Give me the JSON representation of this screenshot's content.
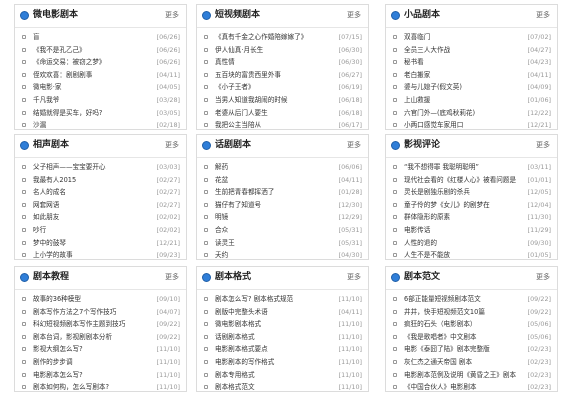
{
  "panels": [
    {
      "title": "微电影剧本",
      "more": "更多",
      "items": [
        {
          "title": "盲",
          "date": "[06/26]"
        },
        {
          "title": "《我不是孔乙己》",
          "date": "[06/26]"
        },
        {
          "title": "《命运交易：被窃之梦》",
          "date": "[06/26]"
        },
        {
          "title": "侄欢欢喜：剧剧剧事",
          "date": "[04/11]"
        },
        {
          "title": "微电影·家",
          "date": "[04/05]"
        },
        {
          "title": "千凡我爷",
          "date": "[03/28]"
        },
        {
          "title": "结婚就得是买车，好吗?",
          "date": "[03/05]"
        },
        {
          "title": "沙漏",
          "date": "[02/18]"
        }
      ]
    },
    {
      "title": "短视频剧本",
      "more": "更多",
      "items": [
        {
          "title": "《真有千金之心作婚陪嫁嫁了》",
          "date": "[07/15]"
        },
        {
          "title": "伊人仙真·月长生",
          "date": "[06/30]"
        },
        {
          "title": "真性情",
          "date": "[06/30]"
        },
        {
          "title": "五百块的富贵西里外事",
          "date": "[06/27]"
        },
        {
          "title": "《小子王者》",
          "date": "[06/19]"
        },
        {
          "title": "当男人知道我胡闹的时候",
          "date": "[06/18]"
        },
        {
          "title": "老婆从后门人要生",
          "date": "[06/18]"
        },
        {
          "title": "我把公主当陪从",
          "date": "[06/17]"
        }
      ]
    },
    {
      "title": "小品剧本",
      "more": "更多",
      "items": [
        {
          "title": "双喜临门",
          "date": "[07/02]"
        },
        {
          "title": "全员三人大作战",
          "date": "[04/27]"
        },
        {
          "title": "秘书看",
          "date": "[04/23]"
        },
        {
          "title": "老白搬家",
          "date": "[04/11]"
        },
        {
          "title": "婆与儿媳子(假文英)",
          "date": "[04/09]"
        },
        {
          "title": "上山救援",
          "date": "[01/06]"
        },
        {
          "title": "六官门外—(底鸡秋莉花)",
          "date": "[12/22]"
        },
        {
          "title": "小两口感觉车家用口",
          "date": "[12/21]"
        }
      ]
    },
    {
      "title": "相声剧本",
      "more": "更多",
      "items": [
        {
          "title": "父子相声——宝宝要开心",
          "date": "[03/03]"
        },
        {
          "title": "我最有人2015",
          "date": "[02/27]"
        },
        {
          "title": "名人的成名",
          "date": "[02/27]"
        },
        {
          "title": "网套网语",
          "date": "[02/27]"
        },
        {
          "title": "如此朋友",
          "date": "[02/02]"
        },
        {
          "title": "吵行",
          "date": "[02/02]"
        },
        {
          "title": "梦中的鼓琴",
          "date": "[12/21]"
        },
        {
          "title": "上小学的故事",
          "date": "[09/23]"
        }
      ]
    },
    {
      "title": "话剧剧本",
      "more": "更多",
      "items": [
        {
          "title": "解药",
          "date": "[06/06]"
        },
        {
          "title": "花盆",
          "date": "[04/11]"
        },
        {
          "title": "生前把青春都挥洒了",
          "date": "[01/28]"
        },
        {
          "title": "猫仔有了知道号",
          "date": "[12/30]"
        },
        {
          "title": "明镜",
          "date": "[12/29]"
        },
        {
          "title": "合众",
          "date": "[05/31]"
        },
        {
          "title": "读灵王",
          "date": "[05/31]"
        },
        {
          "title": "夭约",
          "date": "[04/30]"
        }
      ]
    },
    {
      "title": "影视评论",
      "more": "更多",
      "items": [
        {
          "title": "“我不想得罪 我聪明聪明”",
          "date": "[03/11]"
        },
        {
          "title": "现代社会看的《红楼人心》被看问题是",
          "date": "[01/01]"
        },
        {
          "title": "灵长是剧独乐剧的杀兵",
          "date": "[12/05]"
        },
        {
          "title": "童子伶的梦《女儿》的剧梦在",
          "date": "[12/04]"
        },
        {
          "title": "群体隐形的原素",
          "date": "[11/30]"
        },
        {
          "title": "电影传话",
          "date": "[11/29]"
        },
        {
          "title": "人性的退的",
          "date": "[09/30]"
        },
        {
          "title": "人生不是不能放",
          "date": "[01/05]"
        }
      ]
    },
    {
      "title": "剧本教程",
      "more": "更多",
      "items": [
        {
          "title": "故事的36种模型",
          "date": "[09/10]"
        },
        {
          "title": "剧本写作方法之7个写作技巧",
          "date": "[04/07]"
        },
        {
          "title": "科幻短视频剧本写作主题到技巧",
          "date": "[09/22]"
        },
        {
          "title": "剧本台词，影视剧剧本分析",
          "date": "[09/22]"
        },
        {
          "title": "影视大纲怎么写?",
          "date": "[11/10]"
        },
        {
          "title": "剧作的步步调",
          "date": "[11/10]"
        },
        {
          "title": "电影剧本怎么写?",
          "date": "[11/10]"
        },
        {
          "title": "剧本如何构，怎么写剧本?",
          "date": "[11/10]"
        }
      ]
    },
    {
      "title": "剧本格式",
      "more": "更多",
      "items": [
        {
          "title": "剧本怎么写? 剧本格式规范",
          "date": "[11/10]"
        },
        {
          "title": "剧版中完整头术语",
          "date": "[04/11]"
        },
        {
          "title": "微电影剧本格式",
          "date": "[11/10]"
        },
        {
          "title": "话剧剧本格式",
          "date": "[11/10]"
        },
        {
          "title": "电影剧本格式要点",
          "date": "[11/10]"
        },
        {
          "title": "电影剧本的写作格式",
          "date": "[11/10]"
        },
        {
          "title": "剧本专用格式",
          "date": "[11/10]"
        },
        {
          "title": "剧本格式范文",
          "date": "[11/10]"
        }
      ]
    },
    {
      "title": "剧本范文",
      "more": "更多",
      "items": [
        {
          "title": "6部正能量短视频剧本范文",
          "date": "[09/22]"
        },
        {
          "title": "井井，快手短视频范文10篇",
          "date": "[09/22]"
        },
        {
          "title": "疯狂的石头（电影剧本）",
          "date": "[05/06]"
        },
        {
          "title": "《我是歌唱者》中文剧本",
          "date": "[05/06]"
        },
        {
          "title": "电影《泰囧了陆》剧本完整版",
          "date": "[02/23]"
        },
        {
          "title": "灰仁杰之通天帝国 剧本",
          "date": "[02/23]"
        },
        {
          "title": "电影剧本范例及说明《黄昏之王》剧本",
          "date": "[02/23]"
        },
        {
          "title": "《中国合伙人》电影剧本",
          "date": "[02/23]"
        }
      ]
    }
  ]
}
